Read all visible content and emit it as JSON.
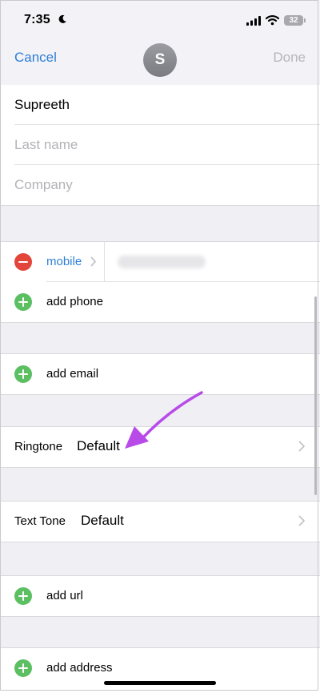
{
  "status_bar": {
    "time": "7:35",
    "battery": "32"
  },
  "nav": {
    "cancel": "Cancel",
    "avatar_initial": "S",
    "done": "Done"
  },
  "name_section": {
    "first_name": "Supreeth",
    "last_name_placeholder": "Last name",
    "company_placeholder": "Company"
  },
  "phone_section": {
    "mobile_label": "mobile",
    "add_phone": "add phone"
  },
  "email_section": {
    "add_email": "add email"
  },
  "ringtone": {
    "label": "Ringtone",
    "value": "Default"
  },
  "text_tone": {
    "label": "Text Tone",
    "value": "Default"
  },
  "url_section": {
    "add_url": "add url"
  },
  "address_section": {
    "add_address": "add address"
  },
  "colors": {
    "accent": "#2f7fd6",
    "add": "#5cbf62",
    "remove": "#e3453a",
    "annotation_arrow": "#b84be8"
  },
  "icons": [
    "moon-icon",
    "signal-icon",
    "wifi-icon",
    "battery-icon",
    "minus-icon",
    "plus-icon",
    "chevron-right-icon",
    "annotation-arrow"
  ]
}
